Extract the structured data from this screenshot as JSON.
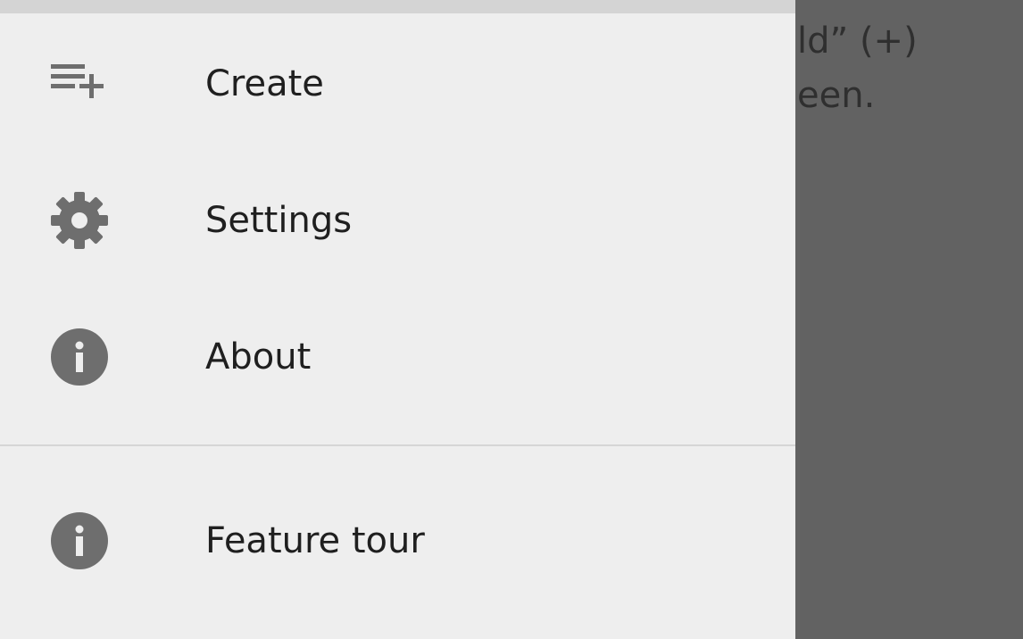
{
  "background_text": {
    "line_1": "ld” (+)",
    "line_2": "een."
  },
  "drawer": {
    "items": [
      {
        "label": "Create",
        "icon": "playlist-add-icon"
      },
      {
        "label": "Settings",
        "icon": "gear-icon"
      },
      {
        "label": "About",
        "icon": "info-icon"
      }
    ],
    "secondary_items": [
      {
        "label": "Feature tour",
        "icon": "info-icon"
      }
    ]
  },
  "colors": {
    "drawer_background": "#eeeeee",
    "scrim": "#626262",
    "icon": "#6e6e6e",
    "text": "#1f1f1f"
  }
}
